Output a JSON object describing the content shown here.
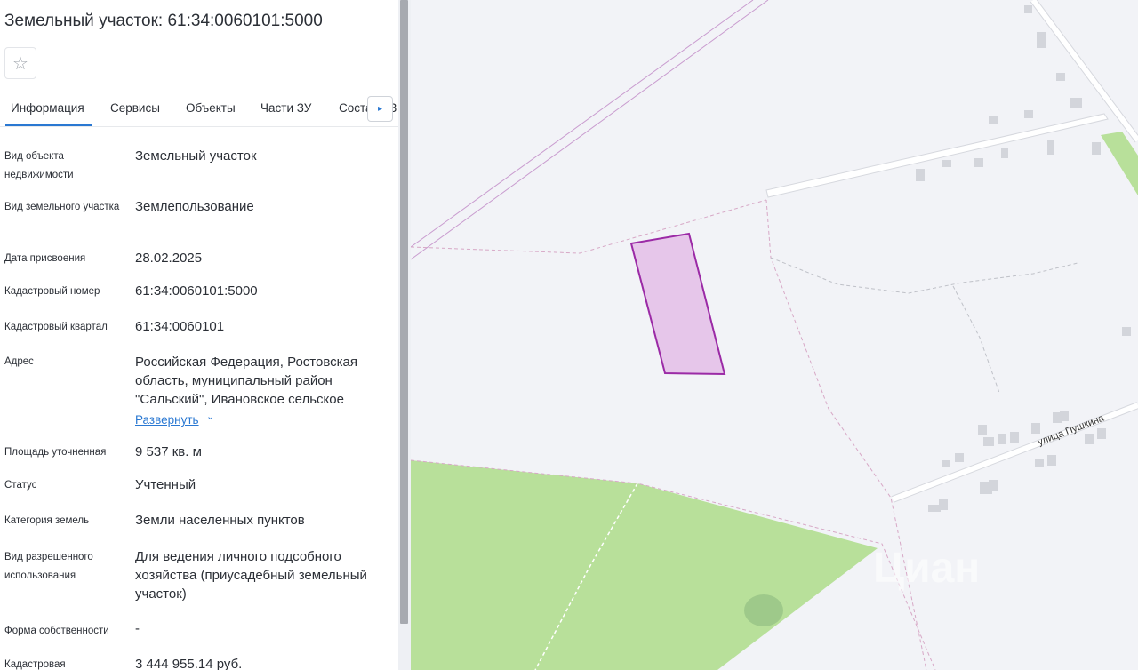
{
  "header": {
    "title": "Земельный участок: 61:34:0060101:5000"
  },
  "favorite": {
    "icon": "star-icon",
    "glyph": "☆"
  },
  "tabs": [
    {
      "label": "Информация",
      "active": true
    },
    {
      "label": "Сервисы",
      "active": false
    },
    {
      "label": "Объекты",
      "active": false
    },
    {
      "label": "Части ЗУ",
      "active": false
    },
    {
      "label": "Состав ЕЗ",
      "active": false
    }
  ],
  "tab_next_glyph": "▸",
  "info": [
    {
      "label": "Вид объекта недвижимости",
      "value": "Земельный участок"
    },
    {
      "label": "Вид земельного участка",
      "value": "Землепользование"
    },
    {
      "label": "Дата присвоения",
      "value": "28.02.2025"
    },
    {
      "label": "Кадастровый номер",
      "value": "61:34:0060101:5000"
    },
    {
      "label": "Кадастровый квартал",
      "value": "61:34:0060101"
    },
    {
      "label": "Адрес",
      "value": "Российская Федерация, Ростовская область, муниципальный район \"Сальский\", Ивановское сельское"
    },
    {
      "label": "Площадь уточненная",
      "value": "9 537 кв. м"
    },
    {
      "label": "Статус",
      "value": "Учтенный"
    },
    {
      "label": "Категория земель",
      "value": "Земли населенных пунктов"
    },
    {
      "label": "Вид разрешенного использования",
      "value": "Для ведения личного подсобного хозяйства (приусадебный земельный участок)"
    },
    {
      "label": "Форма собственности",
      "value": "-"
    },
    {
      "label": "Кадастровая",
      "value": "3 444 955.14 руб."
    }
  ],
  "expand": {
    "label": "Развернуть",
    "chevron": "⌄"
  },
  "map": {
    "street_label": "улица Пушкина",
    "watermark": "Циан",
    "colors": {
      "parcel_fill": "#e6c6ea",
      "parcel_stroke": "#9b2aa6",
      "green": "#b8e09a",
      "accent": "#2a78d2"
    }
  }
}
